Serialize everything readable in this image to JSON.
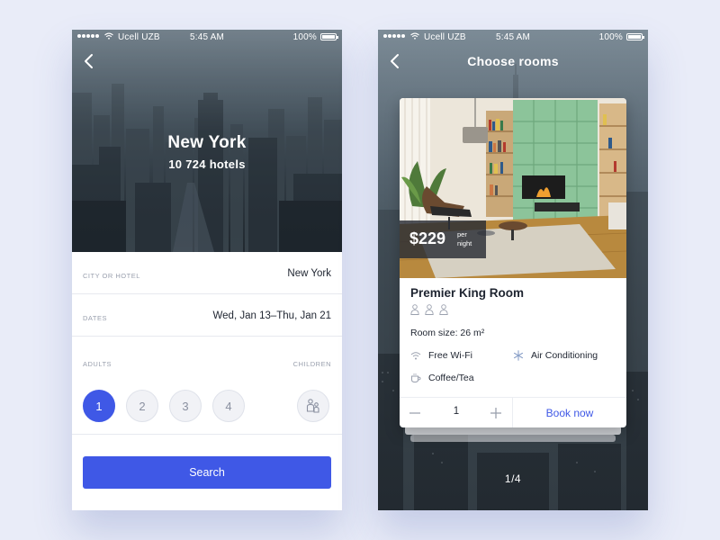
{
  "status_bar": {
    "carrier": "Ucell UZB",
    "time": "5:45 AM",
    "battery": "100%"
  },
  "search_screen": {
    "city_title": "New York",
    "hotel_count": "10 724 hotels",
    "fields": [
      {
        "label": "CITY OR HOTEL",
        "value": "New York"
      },
      {
        "label": "DATES",
        "value": "Wed, Jan 13–Thu, Jan 21"
      }
    ],
    "adults_label": "ADULTS",
    "children_label": "CHILDREN",
    "adult_options": [
      "1",
      "2",
      "3",
      "4"
    ],
    "selected_adults": "1",
    "search_button": "Search",
    "accent_color": "#3f58e6"
  },
  "rooms_screen": {
    "title": "Choose rooms",
    "room": {
      "price": "$229",
      "price_unit_line1": "per",
      "price_unit_line2": "night",
      "name": "Premier King Room",
      "guest_capacity": 3,
      "size_label": "Room size: 26 m²",
      "amenities": [
        {
          "icon": "wifi-icon",
          "label": "Free Wi-Fi"
        },
        {
          "icon": "snowflake-icon",
          "label": "Air Conditioning"
        },
        {
          "icon": "cup-icon",
          "label": "Coffee/Tea"
        }
      ],
      "quantity": "1",
      "book_button": "Book now"
    },
    "pager": "1/4"
  }
}
